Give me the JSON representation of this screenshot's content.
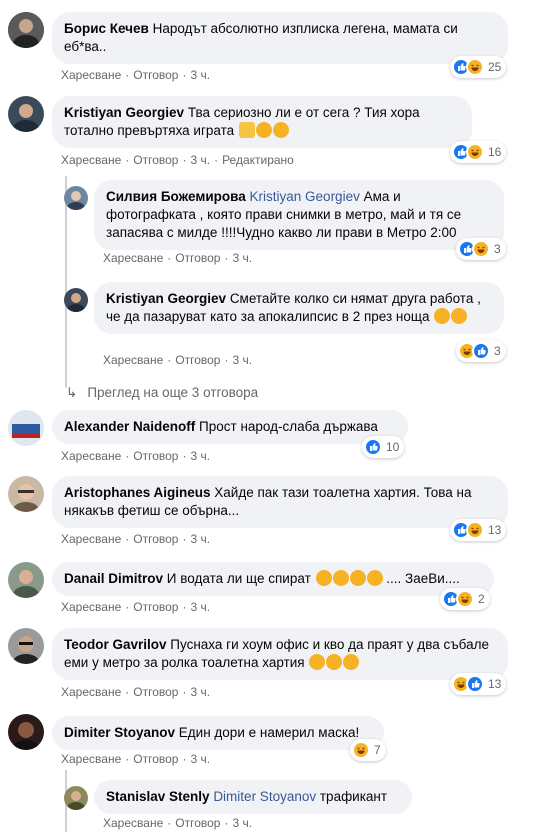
{
  "actions": {
    "like": "Харесване",
    "reply": "Отговор",
    "edited": "Редактирано"
  },
  "more_replies": "Преглед на още 3 отговора",
  "comments": [
    {
      "author": "Борис Кечев",
      "mention": "",
      "text": "Народът абсолютно изплиска легена, мамата си еб*ва..",
      "time": "3 ч.",
      "reactions": [
        "like",
        "haha"
      ],
      "count": "25"
    },
    {
      "author": "Kristiyan Georgiev",
      "mention": "",
      "text": "Тва сериозно ли е от сега ? Тия хора тотално превъртяха играта",
      "time": "3 ч.",
      "edited": true,
      "reactions": [
        "like",
        "haha"
      ],
      "count": "16"
    },
    {
      "author": "Силвия Божемирова",
      "mention": "Kristiyan Georgiev",
      "text": "Ама и фотографката , която прави снимки в метро, май и тя се запасява с милде !!!!Чудно какво ли прави в Метро 2:00",
      "time": "3 ч.",
      "reactions": [
        "like",
        "haha"
      ],
      "count": "3"
    },
    {
      "author": "Kristiyan Georgiev",
      "mention": "",
      "text": "Сметайте колко си нямат друга работа , че да пазаруват като за апокалипсис в 2 през ноща",
      "time": "3 ч.",
      "reactions": [
        "haha",
        "like"
      ],
      "count": "3"
    },
    {
      "author": "Alexander Naidenoff",
      "mention": "",
      "text": "Прост народ-слаба държава",
      "time": "3 ч.",
      "reactions": [
        "like"
      ],
      "count": "10"
    },
    {
      "author": "Aristophanes Aigineus",
      "mention": "",
      "text": "Хайде пак тази тоалетна хартия. Това на някакъв фетиш се обърна...",
      "time": "3 ч.",
      "reactions": [
        "like",
        "haha"
      ],
      "count": "13"
    },
    {
      "author": "Danail Dimitrov",
      "mention": "",
      "text": "И водата ли ще спират",
      "text2": ".... ЗаеВи....",
      "time": "3 ч.",
      "reactions": [
        "like",
        "haha"
      ],
      "count": "2"
    },
    {
      "author": "Teodor Gavrilov",
      "mention": "",
      "text": "Пуснаха ги хоум офис и кво да праят у два събале еми у метро за ролка тоалетна хартия",
      "time": "3 ч.",
      "reactions": [
        "haha",
        "like"
      ],
      "count": "13"
    },
    {
      "author": "Dimiter Stoyanov",
      "mention": "",
      "text": "Един дори е намерил маска!",
      "time": "3 ч.",
      "reactions": [
        "haha"
      ],
      "count": "7"
    },
    {
      "author": "Stanislav Stenly",
      "mention": "Dimiter Stoyanov",
      "text": "трафикант",
      "time": "3 ч."
    }
  ],
  "colors": {
    "bubble": "#f0f2f5",
    "like": "#1877f2",
    "haha": "#f7b125",
    "mention": "#385898",
    "meta": "#65676b"
  }
}
